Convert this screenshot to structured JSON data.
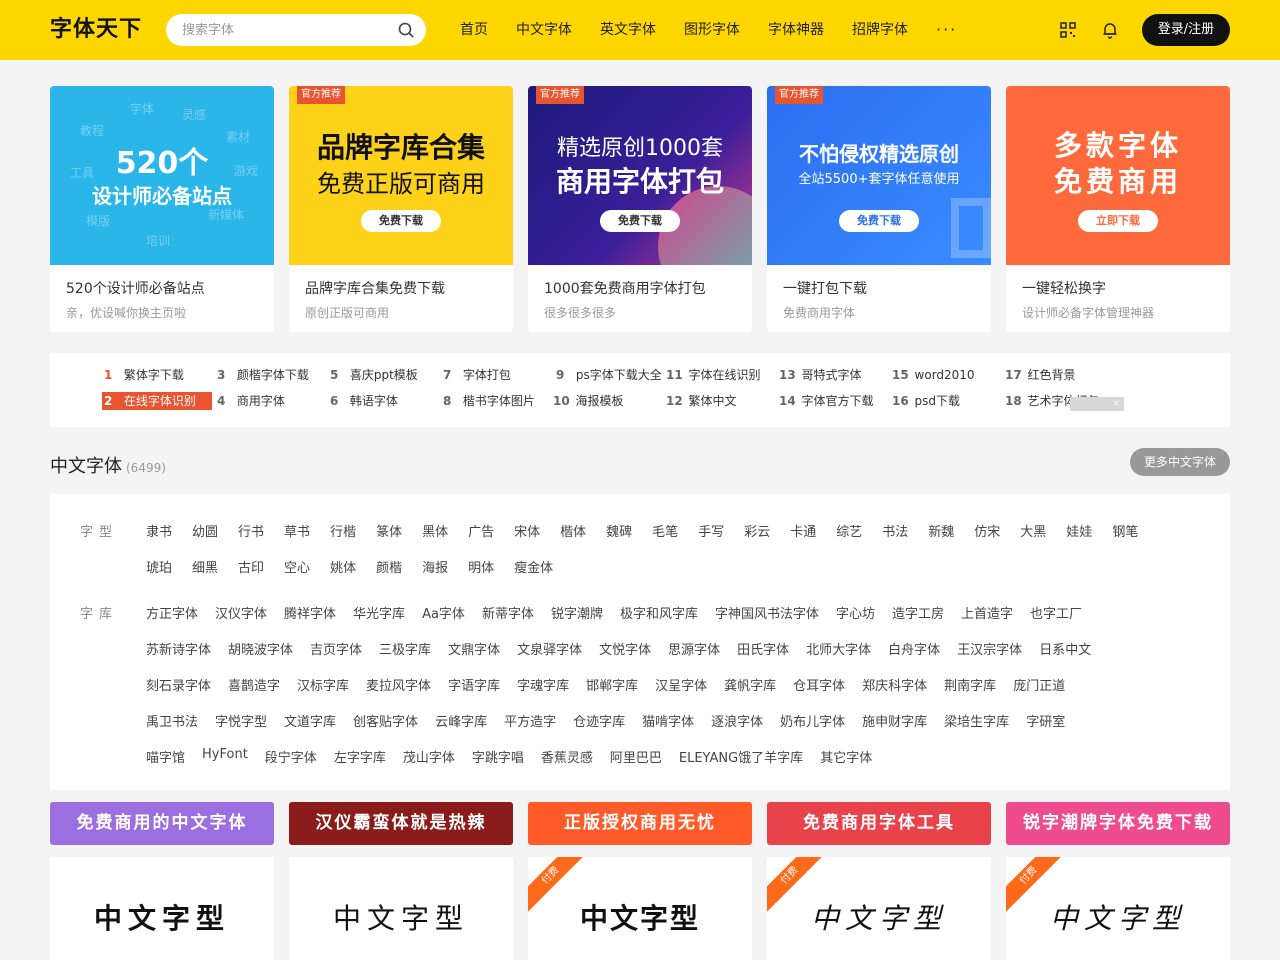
{
  "header": {
    "logo": "字体天下",
    "search_placeholder": "搜索字体",
    "nav": [
      "首页",
      "中文字体",
      "英文字体",
      "图形字体",
      "字体神器",
      "招牌字体"
    ],
    "nav_more": "···",
    "login": "登录/注册"
  },
  "banners": [
    {
      "line1": "520个",
      "line2": "设计师必备站点",
      "title": "520个设计师必备站点",
      "sub": "亲，优设喊你换主页啦",
      "bg": "#2bb6ea"
    },
    {
      "tag": "官方推荐",
      "line1": "品牌字库合集",
      "line2": "免费正版可商用",
      "btn": "免费下载",
      "title": "品牌字库合集免费下载",
      "sub": "原创正版可商用",
      "bg": "#ffd21a"
    },
    {
      "tag": "官方推荐",
      "line1": "精选原创1000套",
      "line2": "商用字体打包",
      "btn": "免费下载",
      "title": "1000套免费商用字体打包",
      "sub": "很多很多很多",
      "bg": "#1b1a7a"
    },
    {
      "tag": "官方推荐",
      "line1": "不怕侵权精选原创",
      "line2": "全站5500+套字体任意使用",
      "btn": "免费下载",
      "title": "一键打包下载",
      "sub": "免费商用字体",
      "bg": "#2b6ef2"
    },
    {
      "line1": "多款字体",
      "line2": "免费商用",
      "btn": "立即下载",
      "title": "一键轻松换字",
      "sub": "设计师必备字体管理神器",
      "bg": "#ff6a3c"
    }
  ],
  "banner_float_words": [
    "字体",
    "灵感",
    "教程",
    "素材",
    "工具",
    "模版",
    "培训",
    "新媒体",
    "游戏"
  ],
  "hot": [
    {
      "num": "1",
      "text": "繁体字下载"
    },
    {
      "num": "2",
      "text": "在线字体识别"
    },
    {
      "num": "3",
      "text": "颜楷字体下载"
    },
    {
      "num": "4",
      "text": "商用字体"
    },
    {
      "num": "5",
      "text": "喜庆ppt模板"
    },
    {
      "num": "6",
      "text": "韩语字体"
    },
    {
      "num": "7",
      "text": "字体打包"
    },
    {
      "num": "8",
      "text": "楷书字体图片"
    },
    {
      "num": "9",
      "text": "ps字体下载大全"
    },
    {
      "num": "10",
      "text": "海报模板"
    },
    {
      "num": "11",
      "text": "字体在线识别"
    },
    {
      "num": "12",
      "text": "繁体中文"
    },
    {
      "num": "13",
      "text": "哥特式字体"
    },
    {
      "num": "14",
      "text": "字体官方下载"
    },
    {
      "num": "15",
      "text": "word2010"
    },
    {
      "num": "16",
      "text": "psd下载"
    },
    {
      "num": "17",
      "text": "红色背景"
    },
    {
      "num": "18",
      "text": "艺术字体打包"
    }
  ],
  "section": {
    "title": "中文字体",
    "count": "(6499)",
    "more": "更多中文字体"
  },
  "categories": {
    "type_label": "字型",
    "types": [
      "隶书",
      "幼圆",
      "行书",
      "草书",
      "行楷",
      "篆体",
      "黑体",
      "广告",
      "宋体",
      "楷体",
      "魏碑",
      "毛笔",
      "手写",
      "彩云",
      "卡通",
      "综艺",
      "书法",
      "新魏",
      "仿宋",
      "大黑",
      "娃娃",
      "钢笔",
      "琥珀",
      "细黑",
      "古印",
      "空心",
      "姚体",
      "颜楷",
      "海报",
      "明体",
      "瘦金体"
    ],
    "lib_label": "字库",
    "libs": [
      "方正字体",
      "汉仪字体",
      "腾祥字体",
      "华光字库",
      "Aa字体",
      "新蒂字体",
      "锐字潮牌",
      "极字和风字库",
      "字神国风书法字体",
      "字心坊",
      "造字工房",
      "上首造字",
      "也字工厂",
      "苏新诗字体",
      "胡晓波字体",
      "吉页字体",
      "三极字库",
      "文鼎字体",
      "文泉驿字体",
      "文悦字体",
      "思源字体",
      "田氏字体",
      "北师大字体",
      "白舟字体",
      "王汉宗字体",
      "日系中文",
      "刻石录字体",
      "喜鹊造字",
      "汉标字库",
      "麦拉风字体",
      "字语字库",
      "字魂字库",
      "邯郸字库",
      "汉呈字体",
      "龚帆字库",
      "仓耳字体",
      "郑庆科字体",
      "荆南字库",
      "庞门正道",
      "禹卫书法",
      "字悦字型",
      "文道字库",
      "创客贴字体",
      "云峰字库",
      "平方造字",
      "仓迹字库",
      "猫啃字体",
      "逐浪字体",
      "奶布儿字体",
      "施申财字库",
      "梁培生字库",
      "字研室",
      "喵字馆",
      "HyFont",
      "段宁字体",
      "左字字库",
      "茂山字体",
      "字跳字唱",
      "香蕉灵感",
      "阿里巴巴",
      "ELEYANG饿了羊字库",
      "其它字体"
    ]
  },
  "strips": [
    {
      "text": "免费商用的中文字体",
      "bg": "#9b6fe0"
    },
    {
      "text": "汉仪霸蛮体就是热辣",
      "bg": "#8b1c1c"
    },
    {
      "text": "正版授权商用无忧",
      "bg": "#ff5a2a"
    },
    {
      "text": "免费商用字体工具",
      "bg": "#e8424a"
    },
    {
      "text": "锐字潮牌字体免费下载",
      "bg": "#ef4c8f"
    }
  ],
  "previews": [
    {
      "text": "中文字型",
      "paid": ""
    },
    {
      "text": "中文字型",
      "paid": ""
    },
    {
      "text": "中文字型",
      "paid": "付费"
    },
    {
      "text": "中文字型",
      "paid": "付费"
    },
    {
      "text": "中文字型",
      "paid": "付费"
    }
  ],
  "ad_close_label": "×"
}
